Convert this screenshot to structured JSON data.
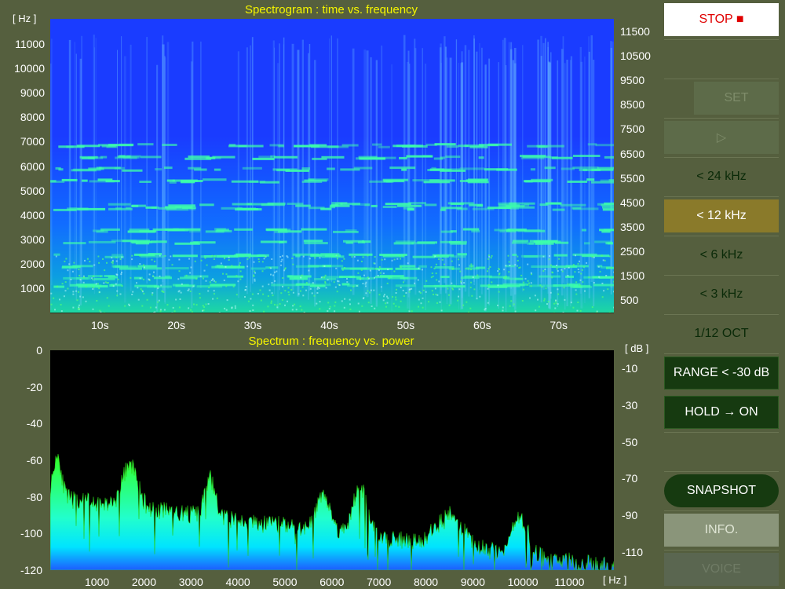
{
  "spectrogram": {
    "title": "Spectrogram : time vs. frequency",
    "unit": "[ Hz ]",
    "left_ticks": [
      "11000",
      "10000",
      "9000",
      "8000",
      "7000",
      "6000",
      "5000",
      "4000",
      "3000",
      "2000",
      "1000"
    ],
    "right_ticks": [
      "11500",
      "10500",
      "9500",
      "8500",
      "7500",
      "6500",
      "5500",
      "4500",
      "3500",
      "2500",
      "1500",
      "500"
    ],
    "time_ticks": [
      "10s",
      "20s",
      "30s",
      "40s",
      "50s",
      "60s",
      "70s"
    ]
  },
  "spectrum": {
    "title": "Spectrum : frequency vs. power",
    "left_ticks": [
      "0",
      "-20",
      "-40",
      "-60",
      "-80",
      "-100",
      "-120"
    ],
    "right_unit": "[ dB ]",
    "right_ticks": [
      "-10",
      "-30",
      "-50",
      "-70",
      "-90",
      "-110"
    ],
    "freq_ticks": [
      "1000",
      "2000",
      "3000",
      "4000",
      "5000",
      "6000",
      "7000",
      "8000",
      "9000",
      "10000",
      "11000"
    ],
    "freq_unit": "[ Hz ]"
  },
  "panel": {
    "stop": "STOP ■",
    "set": "SET",
    "play": "▷",
    "r24": "< 24 kHz",
    "r12": "< 12 kHz",
    "r6": "< 6 kHz",
    "r3": "< 3 kHz",
    "oct": "1/12 OCT",
    "range": "RANGE < -30 dB",
    "hold": "HOLD → ON",
    "snapshot": "SNAPSHOT",
    "info": "INFO.",
    "voice": "VOICE"
  },
  "colors": {
    "background": "#555f3e",
    "title": "#f5f500",
    "stop_text": "#e00000",
    "selected": "#8a7a2a",
    "dark_button": "#163a10"
  }
}
